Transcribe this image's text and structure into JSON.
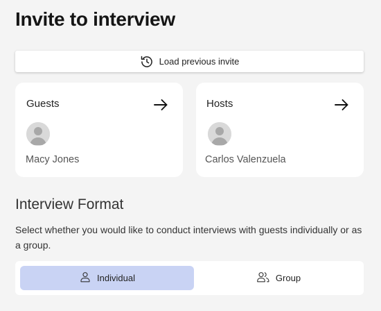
{
  "page": {
    "title": "Invite to interview"
  },
  "load_previous": {
    "label": "Load previous invite",
    "icon": "history-icon"
  },
  "guests": {
    "label": "Guests",
    "people": [
      {
        "name": "Macy Jones"
      }
    ]
  },
  "hosts": {
    "label": "Hosts",
    "people": [
      {
        "name": "Carlos Valenzuela"
      }
    ]
  },
  "interview_format": {
    "title": "Interview Format",
    "description": "Select whether you would like to conduct interviews with guests individually or as a group.",
    "options": [
      {
        "label": "Individual",
        "icon": "person-icon",
        "selected": true
      },
      {
        "label": "Group",
        "icon": "people-icon",
        "selected": false
      }
    ],
    "selected_color": "#c9d3f4"
  }
}
